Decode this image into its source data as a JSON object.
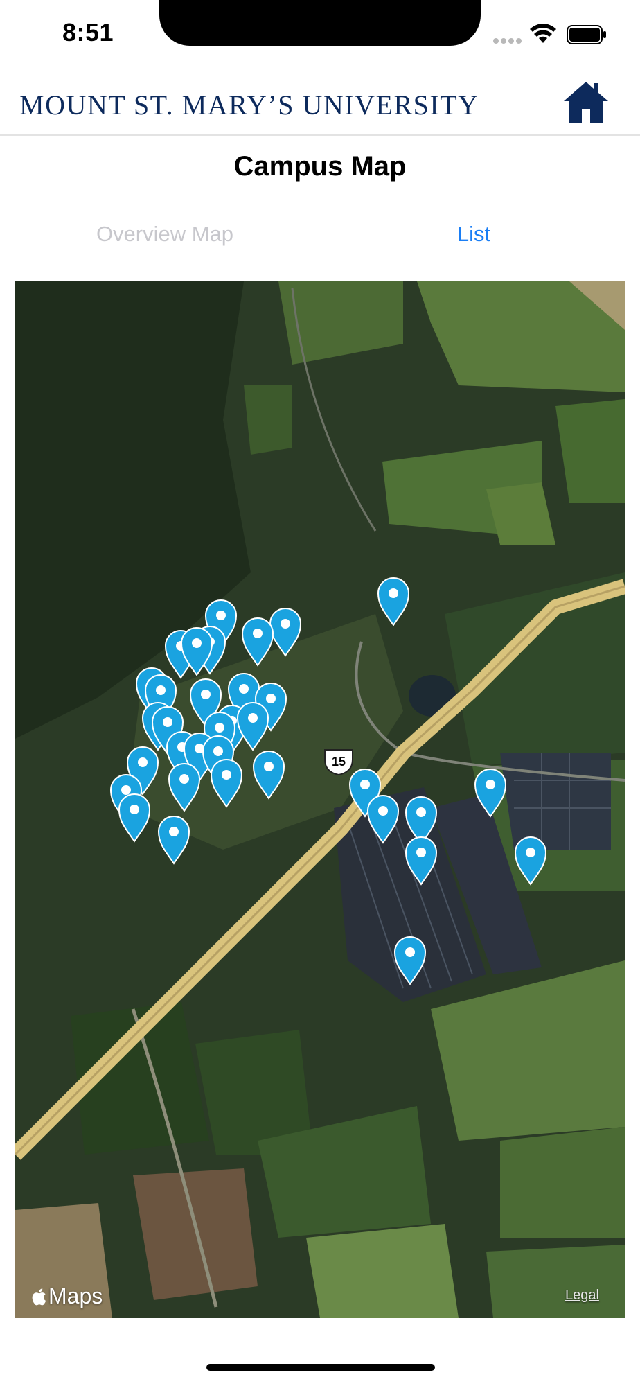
{
  "status_bar": {
    "time": "8:51"
  },
  "header": {
    "logo_text": "MOUNT ST. MARY’S UNIVERSITY",
    "home_icon": "home-icon"
  },
  "page": {
    "title": "Campus Map"
  },
  "tabs": [
    {
      "label": "Overview Map",
      "selected": false
    },
    {
      "label": "List",
      "selected": true
    }
  ],
  "map": {
    "attribution": "Maps",
    "legal_label": "Legal",
    "route_shield": "15",
    "pin_count": 32
  },
  "colors": {
    "brand_navy": "#0d2a5c",
    "accent_blue": "#1a7ef5",
    "pin_blue": "#1aa3e0",
    "tab_inactive": "#c7c7cc"
  }
}
